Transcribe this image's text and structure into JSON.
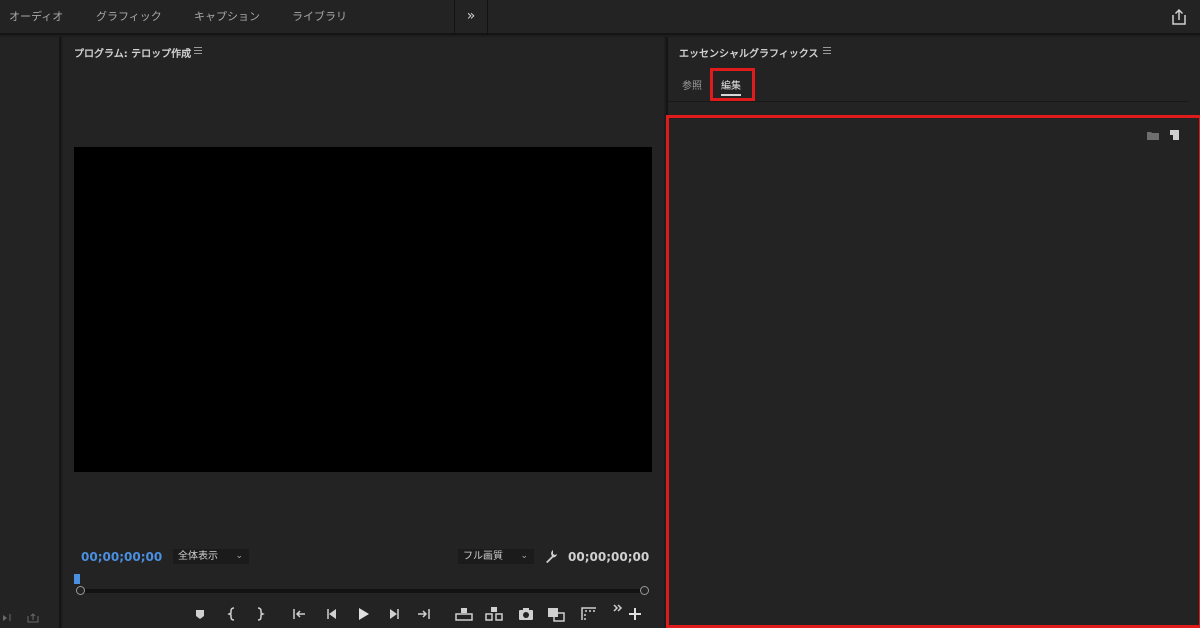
{
  "workspace_tabs": [
    "オーディオ",
    "グラフィック",
    "キャプション",
    "ライブラリ"
  ],
  "workspace_more": "»",
  "program_monitor": {
    "title": "プログラム: テロップ作成",
    "timecode_current": "00;00;00;00",
    "timecode_duration": "00;00;00;00",
    "zoom_dropdown": "全体表示",
    "quality_dropdown": "フル画質"
  },
  "essential_graphics": {
    "title": "エッセンシャルグラフィックス",
    "tabs": [
      "参照",
      "編集"
    ],
    "active_tab": "編集"
  },
  "colors": {
    "accent_blue": "#4a8fe0",
    "highlight_red": "#e01b1b",
    "panel_bg": "#232323"
  },
  "icons": [
    "share-icon",
    "menu-icon",
    "wrench-icon",
    "marker-icon",
    "mark-in-icon",
    "mark-out-icon",
    "go-to-in-icon",
    "step-back-icon",
    "play-icon",
    "step-forward-icon",
    "go-to-out-icon",
    "lift-icon",
    "extract-icon",
    "camera-icon",
    "compare-icon",
    "safe-margins-icon",
    "add-button-icon",
    "folder-icon",
    "new-item-icon"
  ]
}
